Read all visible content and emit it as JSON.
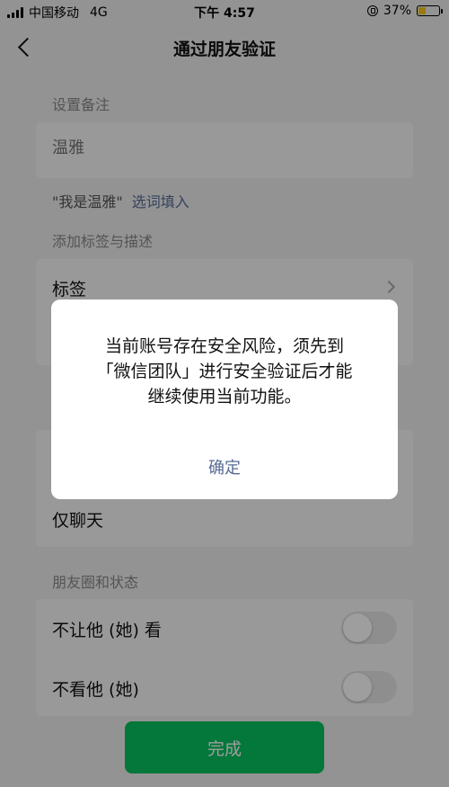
{
  "status_bar": {
    "carrier": "中国移动",
    "network": "4G",
    "time": "下午 4:57",
    "battery_percent": "37%",
    "battery_level": 0.37
  },
  "nav": {
    "title": "通过朋友验证"
  },
  "remark": {
    "section_label": "设置备注",
    "placeholder": "温雅",
    "hint_quote": "\"我是温雅\"",
    "hint_action": "选词填入"
  },
  "tags": {
    "section_label": "添加标签与描述",
    "tag_row_label": "标签"
  },
  "permission": {
    "chat_only_label": "仅聊天"
  },
  "moments": {
    "section_label": "朋友圈和状态",
    "hide_mine_label": "不让他 (她) 看",
    "hide_theirs_label": "不看他 (她)"
  },
  "footer": {
    "done_label": "完成"
  },
  "dialog": {
    "message_line1": "当前账号存在安全风险，须先到",
    "message_line2": "「微信团队」进行安全验证后才能",
    "message_line3": "继续使用当前功能。",
    "confirm_label": "确定"
  },
  "colors": {
    "brand_green": "#07c160",
    "link_blue": "#576b95",
    "battery_yellow": "#f5c518"
  }
}
